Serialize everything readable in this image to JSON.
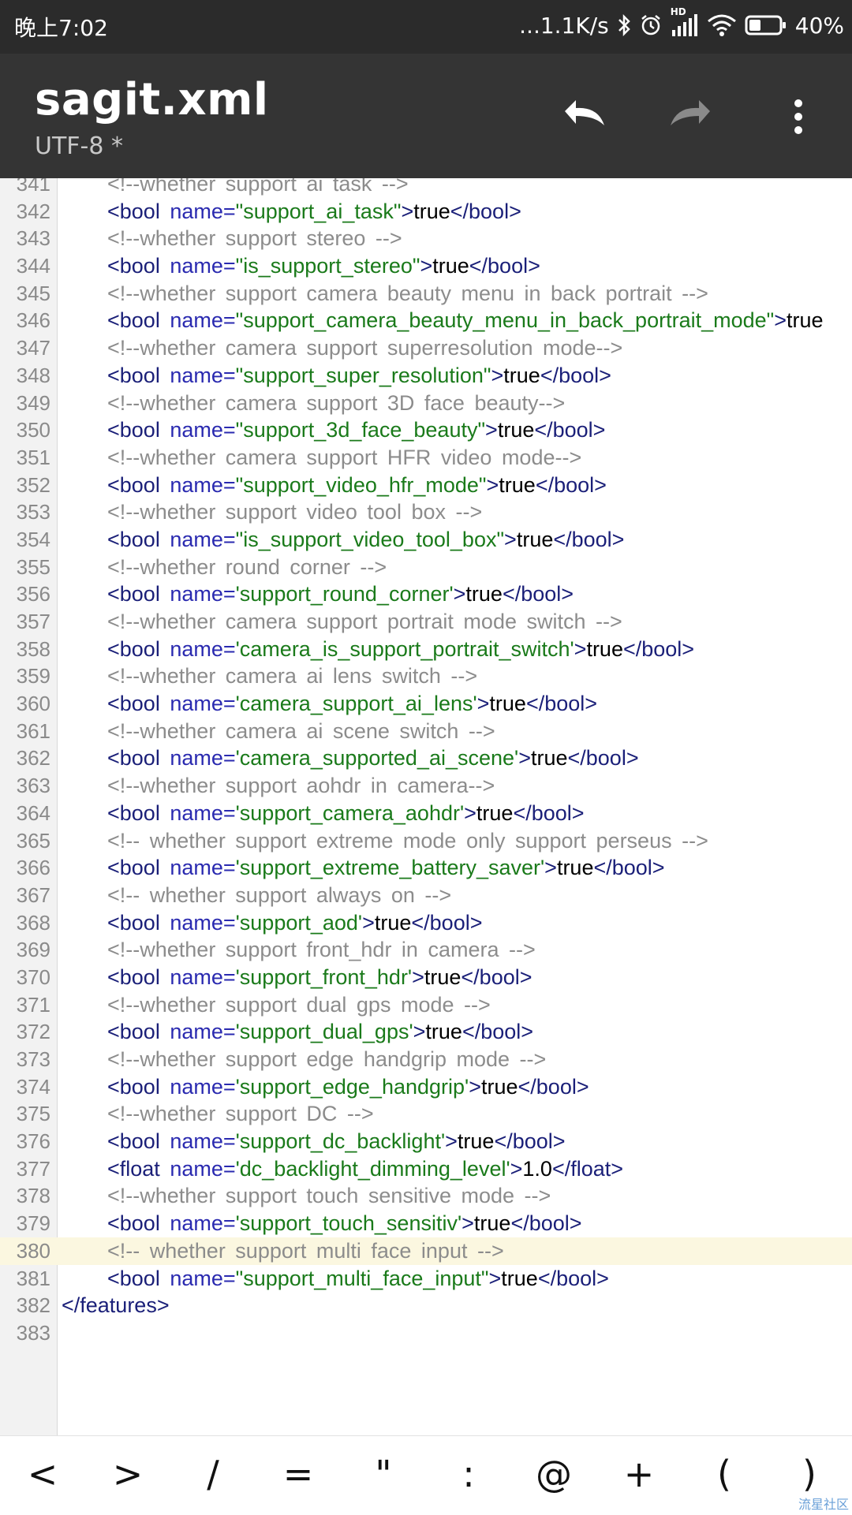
{
  "status_bar": {
    "time": "晚上7:02",
    "net_speed": "...1.1K/s",
    "network_type": "HD",
    "battery_percent": "40%",
    "battery_level": 0.4,
    "icons": [
      "bluetooth-icon",
      "alarm-icon",
      "signal-icon",
      "wifi-icon",
      "battery-icon"
    ]
  },
  "toolbar": {
    "title": "sagit.xml",
    "subtitle": "UTF-8 *",
    "undo_icon": "undo-icon",
    "redo_icon": "redo-icon",
    "menu_icon": "more-vert-icon"
  },
  "colors": {
    "comment": "#8c8c8c",
    "tag": "#1a1f78",
    "attr": "#2a2ab0",
    "value": "#1a7a1a",
    "highlight_line": "#fbf7e0"
  },
  "editor": {
    "highlighted_line": "380",
    "lines": [
      {
        "n": "341",
        "tokens": [
          {
            "t": "comment",
            "v": "<!--whether support ai task -->"
          }
        ]
      },
      {
        "n": "342",
        "tokens": [
          {
            "t": "tag",
            "v": "<bool "
          },
          {
            "t": "attr",
            "v": "name="
          },
          {
            "t": "val",
            "v": "\"support_ai_task\""
          },
          {
            "t": "tag",
            "v": ">"
          },
          {
            "t": "text",
            "v": "true"
          },
          {
            "t": "tag",
            "v": "</bool>"
          }
        ]
      },
      {
        "n": "343",
        "tokens": [
          {
            "t": "comment",
            "v": "<!--whether support stereo -->"
          }
        ]
      },
      {
        "n": "344",
        "tokens": [
          {
            "t": "tag",
            "v": "<bool "
          },
          {
            "t": "attr",
            "v": "name="
          },
          {
            "t": "val",
            "v": "\"is_support_stereo\""
          },
          {
            "t": "tag",
            "v": ">"
          },
          {
            "t": "text",
            "v": "true"
          },
          {
            "t": "tag",
            "v": "</bool>"
          }
        ]
      },
      {
        "n": "345",
        "tokens": [
          {
            "t": "comment",
            "v": "<!--whether support camera beauty menu in back portrait -->"
          }
        ]
      },
      {
        "n": "346",
        "tokens": [
          {
            "t": "tag",
            "v": "<bool "
          },
          {
            "t": "attr",
            "v": "name="
          },
          {
            "t": "val",
            "v": "\"support_camera_beauty_menu_in_back_portrait_mode\""
          },
          {
            "t": "tag",
            "v": ">"
          },
          {
            "t": "text",
            "v": "true"
          }
        ]
      },
      {
        "n": "347",
        "tokens": [
          {
            "t": "comment",
            "v": "<!--whether camera support superresolution mode-->"
          }
        ]
      },
      {
        "n": "348",
        "tokens": [
          {
            "t": "tag",
            "v": "<bool "
          },
          {
            "t": "attr",
            "v": "name="
          },
          {
            "t": "val",
            "v": "\"support_super_resolution\""
          },
          {
            "t": "tag",
            "v": ">"
          },
          {
            "t": "text",
            "v": "true"
          },
          {
            "t": "tag",
            "v": "</bool>"
          }
        ]
      },
      {
        "n": "349",
        "tokens": [
          {
            "t": "comment",
            "v": "<!--whether camera support 3D face beauty-->"
          }
        ]
      },
      {
        "n": "350",
        "tokens": [
          {
            "t": "tag",
            "v": "<bool "
          },
          {
            "t": "attr",
            "v": "name="
          },
          {
            "t": "val",
            "v": "\"support_3d_face_beauty\""
          },
          {
            "t": "tag",
            "v": ">"
          },
          {
            "t": "text",
            "v": "true"
          },
          {
            "t": "tag",
            "v": "</bool>"
          }
        ]
      },
      {
        "n": "351",
        "tokens": [
          {
            "t": "comment",
            "v": "<!--whether camera support HFR video mode-->"
          }
        ]
      },
      {
        "n": "352",
        "tokens": [
          {
            "t": "tag",
            "v": "<bool "
          },
          {
            "t": "attr",
            "v": "name="
          },
          {
            "t": "val",
            "v": "\"support_video_hfr_mode\""
          },
          {
            "t": "tag",
            "v": ">"
          },
          {
            "t": "text",
            "v": "true"
          },
          {
            "t": "tag",
            "v": "</bool>"
          }
        ]
      },
      {
        "n": "353",
        "tokens": [
          {
            "t": "comment",
            "v": "<!--whether support video tool box -->"
          }
        ]
      },
      {
        "n": "354",
        "tokens": [
          {
            "t": "tag",
            "v": "<bool "
          },
          {
            "t": "attr",
            "v": "name="
          },
          {
            "t": "val",
            "v": "\"is_support_video_tool_box\""
          },
          {
            "t": "tag",
            "v": ">"
          },
          {
            "t": "text",
            "v": "true"
          },
          {
            "t": "tag",
            "v": "</bool>"
          }
        ]
      },
      {
        "n": "355",
        "tokens": [
          {
            "t": "comment",
            "v": "<!--whether round corner -->"
          }
        ]
      },
      {
        "n": "356",
        "tokens": [
          {
            "t": "tag",
            "v": "<bool "
          },
          {
            "t": "attr",
            "v": "name="
          },
          {
            "t": "val",
            "v": "'support_round_corner'"
          },
          {
            "t": "tag",
            "v": ">"
          },
          {
            "t": "text",
            "v": "true"
          },
          {
            "t": "tag",
            "v": "</bool>"
          }
        ]
      },
      {
        "n": "357",
        "tokens": [
          {
            "t": "comment",
            "v": "<!--whether camera support portrait mode switch -->"
          }
        ]
      },
      {
        "n": "358",
        "tokens": [
          {
            "t": "tag",
            "v": "<bool "
          },
          {
            "t": "attr",
            "v": "name="
          },
          {
            "t": "val",
            "v": "'camera_is_support_portrait_switch'"
          },
          {
            "t": "tag",
            "v": ">"
          },
          {
            "t": "text",
            "v": "true"
          },
          {
            "t": "tag",
            "v": "</bool>"
          }
        ]
      },
      {
        "n": "359",
        "tokens": [
          {
            "t": "comment",
            "v": "<!--whether camera ai lens switch -->"
          }
        ]
      },
      {
        "n": "360",
        "tokens": [
          {
            "t": "tag",
            "v": "<bool "
          },
          {
            "t": "attr",
            "v": "name="
          },
          {
            "t": "val",
            "v": "'camera_support_ai_lens'"
          },
          {
            "t": "tag",
            "v": ">"
          },
          {
            "t": "text",
            "v": "true"
          },
          {
            "t": "tag",
            "v": "</bool>"
          }
        ]
      },
      {
        "n": "361",
        "tokens": [
          {
            "t": "comment",
            "v": "<!--whether camera ai scene switch -->"
          }
        ]
      },
      {
        "n": "362",
        "tokens": [
          {
            "t": "tag",
            "v": "<bool "
          },
          {
            "t": "attr",
            "v": "name="
          },
          {
            "t": "val",
            "v": "'camera_supported_ai_scene'"
          },
          {
            "t": "tag",
            "v": ">"
          },
          {
            "t": "text",
            "v": "true"
          },
          {
            "t": "tag",
            "v": "</bool>"
          }
        ]
      },
      {
        "n": "363",
        "tokens": [
          {
            "t": "comment",
            "v": "<!--whether support aohdr in camera-->"
          }
        ]
      },
      {
        "n": "364",
        "tokens": [
          {
            "t": "tag",
            "v": "<bool "
          },
          {
            "t": "attr",
            "v": "name="
          },
          {
            "t": "val",
            "v": "'support_camera_aohdr'"
          },
          {
            "t": "tag",
            "v": ">"
          },
          {
            "t": "text",
            "v": "true"
          },
          {
            "t": "tag",
            "v": "</bool>"
          }
        ]
      },
      {
        "n": "365",
        "tokens": [
          {
            "t": "comment",
            "v": "<!-- whether support extreme mode only support perseus -->"
          }
        ]
      },
      {
        "n": "366",
        "tokens": [
          {
            "t": "tag",
            "v": "<bool "
          },
          {
            "t": "attr",
            "v": "name="
          },
          {
            "t": "val",
            "v": "'support_extreme_battery_saver'"
          },
          {
            "t": "tag",
            "v": ">"
          },
          {
            "t": "text",
            "v": "true"
          },
          {
            "t": "tag",
            "v": "</bool>"
          }
        ]
      },
      {
        "n": "367",
        "tokens": [
          {
            "t": "comment",
            "v": "<!-- whether support always on -->"
          }
        ]
      },
      {
        "n": "368",
        "tokens": [
          {
            "t": "tag",
            "v": "<bool "
          },
          {
            "t": "attr",
            "v": "name="
          },
          {
            "t": "val",
            "v": "'support_aod'"
          },
          {
            "t": "tag",
            "v": ">"
          },
          {
            "t": "text",
            "v": "true"
          },
          {
            "t": "tag",
            "v": "</bool>"
          }
        ]
      },
      {
        "n": "369",
        "tokens": [
          {
            "t": "comment",
            "v": "<!--whether support front_hdr in camera -->"
          }
        ]
      },
      {
        "n": "370",
        "tokens": [
          {
            "t": "tag",
            "v": "<bool "
          },
          {
            "t": "attr",
            "v": "name="
          },
          {
            "t": "val",
            "v": "'support_front_hdr'"
          },
          {
            "t": "tag",
            "v": ">"
          },
          {
            "t": "text",
            "v": "true"
          },
          {
            "t": "tag",
            "v": "</bool>"
          }
        ]
      },
      {
        "n": "371",
        "tokens": [
          {
            "t": "comment",
            "v": "<!--whether support dual gps mode -->"
          }
        ]
      },
      {
        "n": "372",
        "tokens": [
          {
            "t": "tag",
            "v": "<bool "
          },
          {
            "t": "attr",
            "v": "name="
          },
          {
            "t": "val",
            "v": "'support_dual_gps'"
          },
          {
            "t": "tag",
            "v": ">"
          },
          {
            "t": "text",
            "v": "true"
          },
          {
            "t": "tag",
            "v": "</bool>"
          }
        ]
      },
      {
        "n": "373",
        "tokens": [
          {
            "t": "comment",
            "v": "<!--whether support edge handgrip mode -->"
          }
        ]
      },
      {
        "n": "374",
        "tokens": [
          {
            "t": "tag",
            "v": "<bool "
          },
          {
            "t": "attr",
            "v": "name="
          },
          {
            "t": "val",
            "v": "'support_edge_handgrip'"
          },
          {
            "t": "tag",
            "v": ">"
          },
          {
            "t": "text",
            "v": "true"
          },
          {
            "t": "tag",
            "v": "</bool>"
          }
        ]
      },
      {
        "n": "375",
        "tokens": [
          {
            "t": "comment",
            "v": "<!--whether support DC -->"
          }
        ]
      },
      {
        "n": "376",
        "tokens": [
          {
            "t": "tag",
            "v": "<bool "
          },
          {
            "t": "attr",
            "v": "name="
          },
          {
            "t": "val",
            "v": "'support_dc_backlight'"
          },
          {
            "t": "tag",
            "v": ">"
          },
          {
            "t": "text",
            "v": "true"
          },
          {
            "t": "tag",
            "v": "</bool>"
          }
        ]
      },
      {
        "n": "377",
        "tokens": [
          {
            "t": "tag",
            "v": "<float "
          },
          {
            "t": "attr",
            "v": "name="
          },
          {
            "t": "val",
            "v": "'dc_backlight_dimming_level'"
          },
          {
            "t": "tag",
            "v": ">"
          },
          {
            "t": "text",
            "v": "1.0"
          },
          {
            "t": "tag",
            "v": "</float>"
          }
        ]
      },
      {
        "n": "378",
        "tokens": [
          {
            "t": "comment",
            "v": "<!--whether support touch sensitive mode -->"
          }
        ]
      },
      {
        "n": "379",
        "tokens": [
          {
            "t": "tag",
            "v": "<bool "
          },
          {
            "t": "attr",
            "v": "name="
          },
          {
            "t": "val",
            "v": "'support_touch_sensitiv'"
          },
          {
            "t": "tag",
            "v": ">"
          },
          {
            "t": "text",
            "v": "true"
          },
          {
            "t": "tag",
            "v": "</bool>"
          }
        ]
      },
      {
        "n": "380",
        "tokens": [
          {
            "t": "comment",
            "v": "<!-- whether support multi face input -->"
          }
        ]
      },
      {
        "n": "381",
        "tokens": [
          {
            "t": "tag",
            "v": "<bool "
          },
          {
            "t": "attr",
            "v": "name="
          },
          {
            "t": "val",
            "v": "\"support_multi_face_input\""
          },
          {
            "t": "tag",
            "v": ">"
          },
          {
            "t": "text",
            "v": "true"
          },
          {
            "t": "tag",
            "v": "</bool>"
          }
        ]
      },
      {
        "n": "382",
        "indent": false,
        "tokens": [
          {
            "t": "tag",
            "v": "</features>"
          }
        ]
      },
      {
        "n": "383",
        "tokens": []
      }
    ]
  },
  "symbol_bar": {
    "keys": [
      "<",
      ">",
      "/",
      "=",
      "\"",
      ":",
      "@",
      "+",
      "(",
      ")"
    ]
  },
  "watermark": "流星社区"
}
